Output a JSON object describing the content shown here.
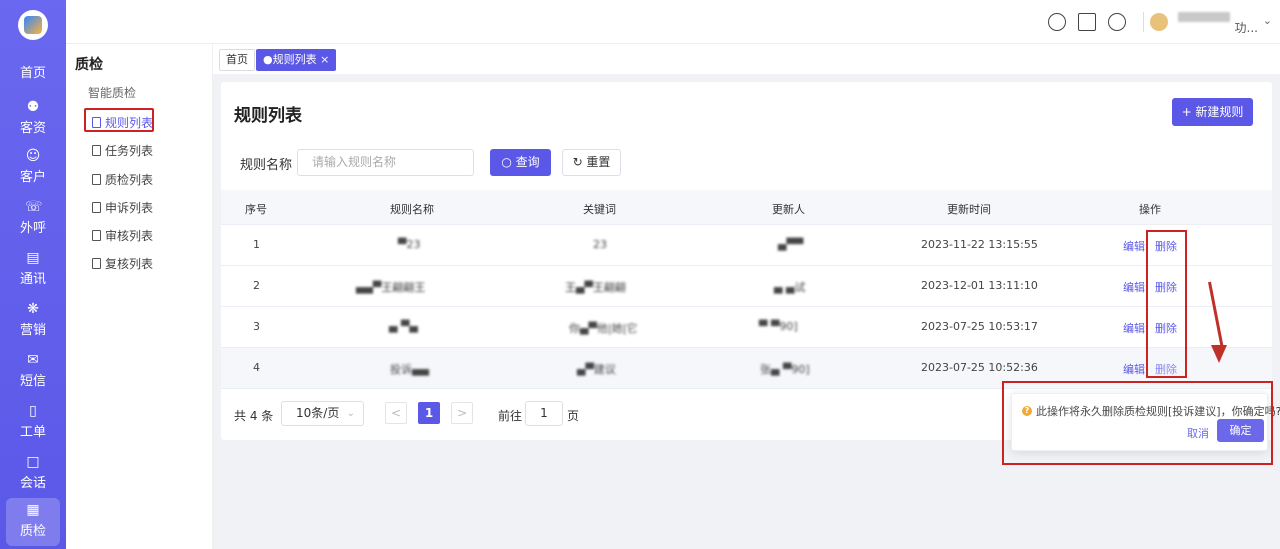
{
  "nav": {
    "items": [
      {
        "label": "首页",
        "icon": "home-icon"
      },
      {
        "label": "客资",
        "icon": "users-icon"
      },
      {
        "label": "客户",
        "icon": "user-icon"
      },
      {
        "label": "外呼",
        "icon": "phone-out-icon"
      },
      {
        "label": "通讯",
        "icon": "contacts-icon"
      },
      {
        "label": "营销",
        "icon": "marketing-icon"
      },
      {
        "label": "短信",
        "icon": "sms-icon"
      },
      {
        "label": "工单",
        "icon": "clipboard-icon"
      },
      {
        "label": "会话",
        "icon": "chat-icon"
      },
      {
        "label": "质检",
        "icon": "qc-icon"
      }
    ],
    "active": "质检"
  },
  "topbar": {
    "icons": [
      "headset-icon",
      "book-icon",
      "message-icon"
    ],
    "user_suffix": "功..."
  },
  "subnav": {
    "title": "质检",
    "group": "智能质检",
    "items": [
      "规则列表",
      "任务列表",
      "质检列表",
      "申诉列表",
      "审核列表",
      "复核列表"
    ],
    "active": "规则列表"
  },
  "tabs": [
    {
      "label": "首页"
    },
    {
      "label": "●规则列表 ×"
    }
  ],
  "page": {
    "title": "规则列表",
    "new_button": "+ 新建规则"
  },
  "filter": {
    "label": "规则名称",
    "placeholder": "请输入规则名称",
    "query": "○ 查询",
    "reset": "↻ 重置"
  },
  "table": {
    "columns": [
      "序号",
      "规则名称",
      "关键词",
      "更新人",
      "更新时间",
      "操作"
    ],
    "rows": [
      {
        "index": "1",
        "name": "▀23",
        "keyword": "23",
        "updater": "▄▀▀",
        "time": "2023-11-22 13:15:55",
        "edit": "编辑",
        "delete": "删除"
      },
      {
        "index": "2",
        "name": "▄▄▀王翩翩王",
        "keyword": "王▄▀王翩翩",
        "updater": "▄ ▄试",
        "time": "2023-12-01 13:11:10",
        "edit": "编辑",
        "delete": "删除"
      },
      {
        "index": "3",
        "name": "▄ ▀▄",
        "keyword": "你▄▀他|她|它",
        "updater": "▀ ▀90]",
        "time": "2023-07-25 10:53:17",
        "edit": "编辑",
        "delete": "删除"
      },
      {
        "index": "4",
        "name": "投诉▄▄",
        "keyword": "▄▀建议",
        "updater": "张▄ ▀90]",
        "time": "2023-07-25 10:52:36",
        "edit": "编辑",
        "delete": "删除"
      }
    ]
  },
  "pager": {
    "total": "共 4 条",
    "size": "10条/页",
    "prev": "<",
    "current": "1",
    "next": ">",
    "goto_prefix": "前往",
    "goto_value": "1",
    "goto_suffix": "页"
  },
  "popconfirm": {
    "icon_mark": "?",
    "message": "此操作将永久删除质检规则[投诉建议]，你确定吗?",
    "cancel": "取消",
    "confirm": "确定"
  },
  "colors": {
    "accent": "#5b58e8",
    "highlight": "#cc2222"
  }
}
